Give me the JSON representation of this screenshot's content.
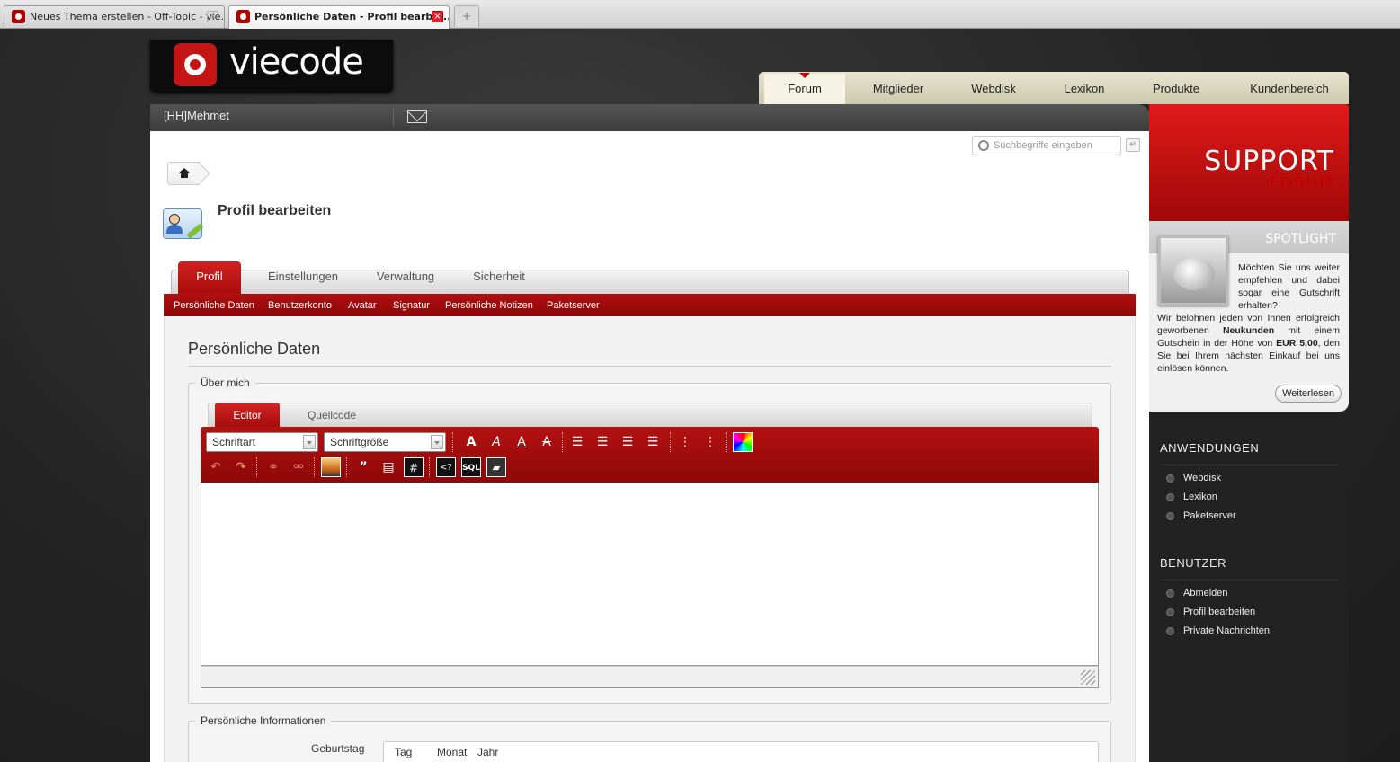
{
  "browser": {
    "tabs": [
      {
        "title": "Neues Thema erstellen - Off-Topic - vie..."
      },
      {
        "title": "Persönliche Daten - Profil bearbe..."
      }
    ],
    "new_tab": "+"
  },
  "brand": {
    "logo_text": "viecode"
  },
  "main_nav": {
    "items": [
      "Forum",
      "Mitglieder",
      "Webdisk",
      "Lexikon",
      "Produkte",
      "Kundenbereich"
    ],
    "active": "Forum"
  },
  "user_bar": {
    "username": "[HH]Mehmet"
  },
  "search": {
    "placeholder": "Suchbegriffe eingeben"
  },
  "page": {
    "title": "Profil bearbeiten"
  },
  "profile_tabs": [
    "Profil",
    "Einstellungen",
    "Verwaltung",
    "Sicherheit"
  ],
  "sub_nav": [
    "Persönliche Daten",
    "Benutzerkonto",
    "Avatar",
    "Signatur",
    "Persönliche Notizen",
    "Paketserver"
  ],
  "section": {
    "title": "Persönliche Daten",
    "about_legend": "Über mich",
    "info_legend": "Persönliche Informationen"
  },
  "editor": {
    "tabs": [
      "Editor",
      "Quellcode"
    ],
    "font_select": "Schriftart",
    "size_select": "Schriftgröße"
  },
  "birthday": {
    "label": "Geburtstag",
    "day": "Tag",
    "month": "Monat",
    "year": "Jahr"
  },
  "sidebar": {
    "support_title": "SUPPORT",
    "support_sub": "FORUM",
    "spotlight": {
      "title": "SPOTLIGHT",
      "text_lead": "Möchten Sie uns weiter empfehlen und dabei sogar eine Gutschrift erhalten?",
      "text_a": "Wir belohnen jeden von Ihnen erfolgreich geworbenen",
      "text_bold": "Neukunden",
      "text_b": "mit einem Gutschein in der Höhe von",
      "text_amount": "EUR 5,00",
      "text_c": ", den Sie bei Ihrem nächsten Einkauf bei uns einlösen können.",
      "more": "Weiterlesen"
    },
    "apps_heading": "ANWENDUNGEN",
    "apps": [
      "Webdisk",
      "Lexikon",
      "Paketserver"
    ],
    "user_heading": "BENUTZER",
    "user_links": [
      "Abmelden",
      "Profil bearbeiten",
      "Private Nachrichten"
    ]
  }
}
